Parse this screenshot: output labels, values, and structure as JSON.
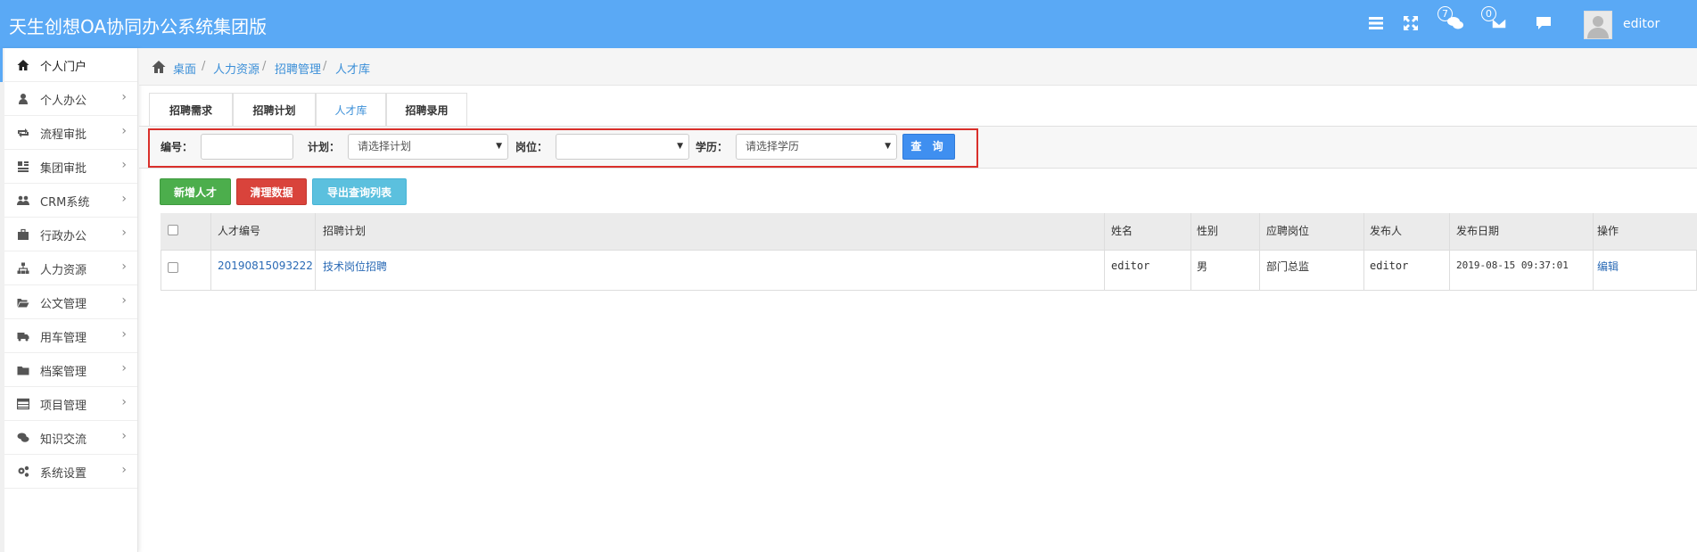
{
  "app": {
    "title": "天生创想OA协同办公系统集团版"
  },
  "topbar": {
    "icons": [
      "menu-icon",
      "fullscreen-icon",
      "chat-icon",
      "mail-icon",
      "comment-icon"
    ],
    "chat_badge": "7",
    "mail_badge": "0",
    "username": "editor"
  },
  "sidebar": {
    "items": [
      {
        "label": "个人门户",
        "icon": "home-icon"
      },
      {
        "label": "个人办公",
        "icon": "user-icon"
      },
      {
        "label": "流程审批",
        "icon": "retweet-icon"
      },
      {
        "label": "集团审批",
        "icon": "list-icon"
      },
      {
        "label": "CRM系统",
        "icon": "users-icon"
      },
      {
        "label": "行政办公",
        "icon": "briefcase-icon"
      },
      {
        "label": "人力资源",
        "icon": "sitemap-icon"
      },
      {
        "label": "公文管理",
        "icon": "folder-open-icon"
      },
      {
        "label": "用车管理",
        "icon": "truck-icon"
      },
      {
        "label": "档案管理",
        "icon": "folder-icon"
      },
      {
        "label": "项目管理",
        "icon": "table-icon"
      },
      {
        "label": "知识交流",
        "icon": "comments-icon"
      },
      {
        "label": "系统设置",
        "icon": "cogs-icon"
      }
    ],
    "arrow": "›"
  },
  "breadcrumb": [
    "桌面",
    "人力资源",
    "招聘管理",
    "人才库"
  ],
  "breadcrumb_sep": "/",
  "tabs": [
    "招聘需求",
    "招聘计划",
    "人才库",
    "招聘录用"
  ],
  "filter": {
    "number_label": "编号：",
    "number_value": "",
    "plan_label": "计划：",
    "plan_value": "请选择计划",
    "position_label": "岗位：",
    "position_value": "",
    "education_label": "学历：",
    "education_value": "请选择学历",
    "query_label": "查 询"
  },
  "actions": {
    "add": "新增人才",
    "clear": "清理数据",
    "export": "导出查询列表"
  },
  "colors": {
    "topbar": "#5aa9f5",
    "add": "#4cae4c",
    "clear": "#d9433b",
    "export": "#5bc0de",
    "query": "#3f8ff0",
    "highlight": "#d9302b"
  },
  "table": {
    "headers": [
      "人才编号",
      "招聘计划",
      "姓名",
      "性别",
      "应聘岗位",
      "发布人",
      "发布日期",
      "操作"
    ],
    "rows": [
      [
        "20190815093222",
        "技术岗位招聘",
        "editor",
        "男",
        "部门总监",
        "editor",
        "2019-08-15 09:37:01",
        "编辑"
      ]
    ]
  }
}
